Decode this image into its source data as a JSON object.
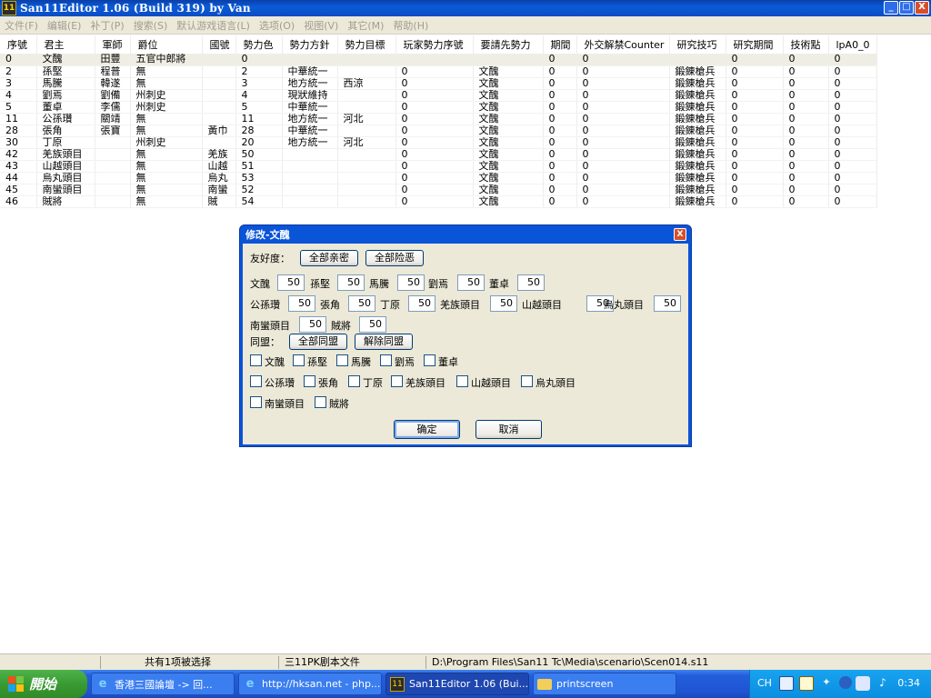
{
  "window": {
    "app_icon": "11",
    "title": "San11Editor 1.06 (Build 319) by Van",
    "minimize": "_",
    "maximize": "□",
    "close": "X"
  },
  "menu": [
    "文件(F)",
    "编辑(E)",
    "补丁(P)",
    "搜索(S)",
    "默认游戏语言(L)",
    "选项(O)",
    "视图(V)",
    "其它(M)",
    "帮助(H)"
  ],
  "columns": [
    "序號",
    "君主",
    "軍師",
    "爵位",
    "國號",
    "勢力色",
    "勢力方針",
    "勢力目標",
    "玩家勢力序號",
    "要請先勢力",
    "期間",
    "外交解禁Counter",
    "研究技巧",
    "研究期間",
    "技術點",
    "lpA0_0"
  ],
  "rows": [
    [
      "0",
      "文醜",
      "田豐",
      "五官中郎將",
      "",
      "0",
      "",
      "",
      "",
      "",
      "0",
      "0",
      "",
      "0",
      "0",
      "0"
    ],
    [
      "2",
      "孫堅",
      "程普",
      "無",
      "",
      "2",
      "中華統一",
      "",
      "0",
      "文醜",
      "0",
      "0",
      "鍛錬槍兵",
      "0",
      "0",
      "0"
    ],
    [
      "3",
      "馬騰",
      "韓遂",
      "無",
      "",
      "3",
      "地方統一",
      "西涼",
      "0",
      "文醜",
      "0",
      "0",
      "鍛錬槍兵",
      "0",
      "0",
      "0"
    ],
    [
      "4",
      "劉焉",
      "劉備",
      "州刺史",
      "",
      "4",
      "現狀維持",
      "",
      "0",
      "文醜",
      "0",
      "0",
      "鍛錬槍兵",
      "0",
      "0",
      "0"
    ],
    [
      "5",
      "董卓",
      "李儒",
      "州刺史",
      "",
      "5",
      "中華統一",
      "",
      "0",
      "文醜",
      "0",
      "0",
      "鍛錬槍兵",
      "0",
      "0",
      "0"
    ],
    [
      "11",
      "公孫瓚",
      "關靖",
      "無",
      "",
      "11",
      "地方統一",
      "河北",
      "0",
      "文醜",
      "0",
      "0",
      "鍛錬槍兵",
      "0",
      "0",
      "0"
    ],
    [
      "28",
      "張角",
      "張寶",
      "無",
      "黃巾",
      "28",
      "中華統一",
      "",
      "0",
      "文醜",
      "0",
      "0",
      "鍛錬槍兵",
      "0",
      "0",
      "0"
    ],
    [
      "30",
      "丁原",
      "",
      "州刺史",
      "",
      "20",
      "地方統一",
      "河北",
      "0",
      "文醜",
      "0",
      "0",
      "鍛錬槍兵",
      "0",
      "0",
      "0"
    ],
    [
      "42",
      "羌族頭目",
      "",
      "無",
      "羌族",
      "50",
      "",
      "",
      "0",
      "文醜",
      "0",
      "0",
      "鍛錬槍兵",
      "0",
      "0",
      "0"
    ],
    [
      "43",
      "山越頭目",
      "",
      "無",
      "山越",
      "51",
      "",
      "",
      "0",
      "文醜",
      "0",
      "0",
      "鍛錬槍兵",
      "0",
      "0",
      "0"
    ],
    [
      "44",
      "烏丸頭目",
      "",
      "無",
      "烏丸",
      "53",
      "",
      "",
      "0",
      "文醜",
      "0",
      "0",
      "鍛錬槍兵",
      "0",
      "0",
      "0"
    ],
    [
      "45",
      "南蠻頭目",
      "",
      "無",
      "南蠻",
      "52",
      "",
      "",
      "0",
      "文醜",
      "0",
      "0",
      "鍛錬槍兵",
      "0",
      "0",
      "0"
    ],
    [
      "46",
      "賊將",
      "",
      "無",
      "賊",
      "54",
      "",
      "",
      "0",
      "文醜",
      "0",
      "0",
      "鍛錬槍兵",
      "0",
      "0",
      "0"
    ]
  ],
  "dialog": {
    "title": "修改-文醜",
    "close": "X",
    "friendship_label": "友好度：",
    "all_friendly": "全部亲密",
    "all_hostile": "全部险恶",
    "friendship": [
      {
        "name": "文醜",
        "value": "50"
      },
      {
        "name": "孫堅",
        "value": "50"
      },
      {
        "name": "馬騰",
        "value": "50"
      },
      {
        "name": "劉焉",
        "value": "50"
      },
      {
        "name": "董卓",
        "value": "50"
      },
      {
        "name": "公孫瓚",
        "value": "50"
      },
      {
        "name": "張角",
        "value": "50"
      },
      {
        "name": "丁原",
        "value": "50"
      },
      {
        "name": "羌族頭目",
        "value": "50"
      },
      {
        "name": "山越頭目",
        "value": "50"
      },
      {
        "name": "烏丸頭目",
        "value": "50"
      },
      {
        "name": "南蠻頭目",
        "value": "50"
      },
      {
        "name": "賊將",
        "value": "50"
      }
    ],
    "alliance_label": "同盟：",
    "all_ally": "全部同盟",
    "remove_ally": "解除同盟",
    "alliance": [
      "文醜",
      "孫堅",
      "馬騰",
      "劉焉",
      "董卓",
      "公孫瓚",
      "張角",
      "丁原",
      "羌族頭目",
      "山越頭目",
      "烏丸頭目",
      "南蠻頭目",
      "賊將"
    ],
    "ok": "确定",
    "cancel": "取消"
  },
  "status": {
    "selected": "共有1项被选择",
    "file_type": "三11PK剧本文件",
    "path": "D:\\Program Files\\San11 Tc\\Media\\scenario\\Scen014.s11"
  },
  "taskbar": {
    "start": "開始",
    "tasks": [
      {
        "label": "香港三國論壇 -> 回...",
        "icon": "ie-icon"
      },
      {
        "label": "http://hksan.net - php...",
        "icon": "ie-icon"
      },
      {
        "label": "San11Editor 1.06 (Bui...",
        "icon": "app-icon",
        "icon_text": "11"
      },
      {
        "label": "printscreen",
        "icon": "folder-icon"
      }
    ],
    "lang": "CH",
    "clock": "0:34"
  }
}
